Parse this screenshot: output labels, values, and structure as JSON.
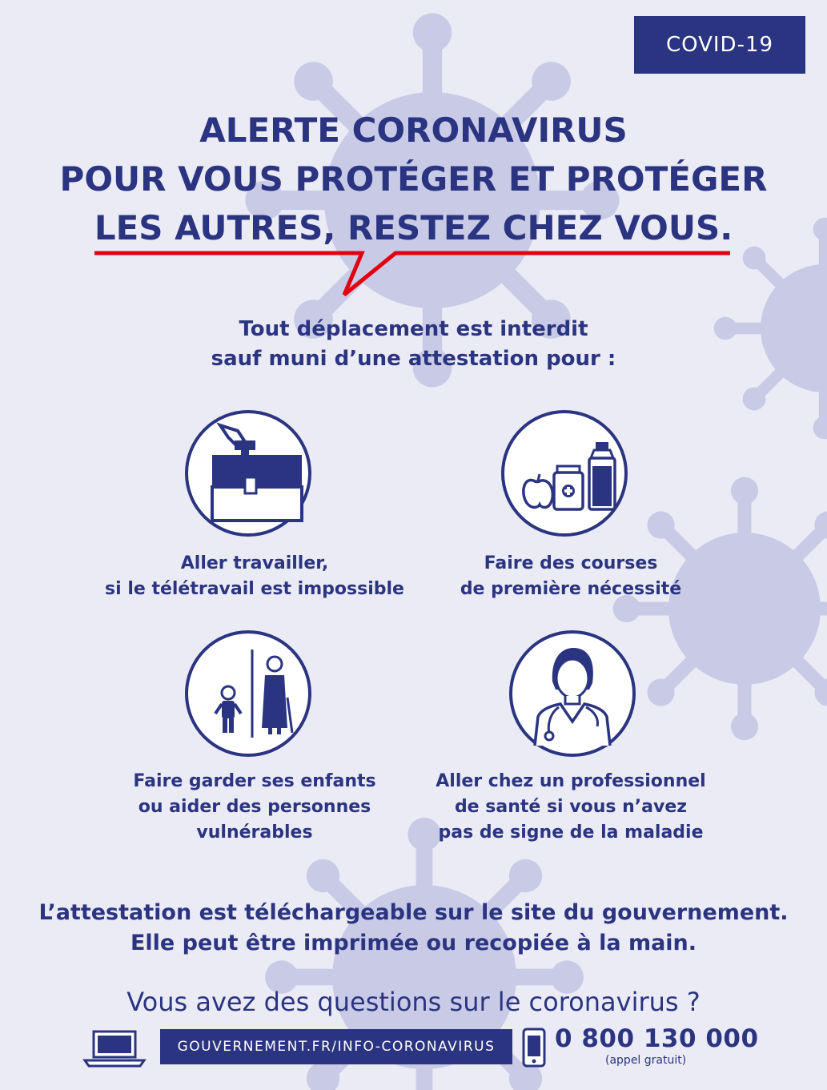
{
  "badge": "COVID-19",
  "headline": [
    "ALERTE CORONAVIRUS",
    "POUR VOUS PROTÉGER ET PROTÉGER",
    "LES AUTRES, RESTEZ CHEZ VOUS."
  ],
  "intro": [
    "Tout déplacement est interdit",
    "sauf muni d’une attestation pour :"
  ],
  "reasons": [
    {
      "icon": "briefcase-icon",
      "lines": [
        "Aller travailler,",
        "si le télétravail est impossible"
      ]
    },
    {
      "icon": "groceries-icon",
      "lines": [
        "Faire des courses",
        "de première nécessité"
      ]
    },
    {
      "icon": "child-elderly-icon",
      "lines": [
        "Faire garder ses enfants",
        "ou aider des personnes",
        "vulnérables"
      ]
    },
    {
      "icon": "doctor-icon",
      "lines": [
        "Aller chez un professionnel",
        "de santé si vous n’avez",
        "pas de signe de la maladie"
      ]
    }
  ],
  "attestation": [
    "L’attestation est téléchargeable sur le site du gouvernement.",
    "Elle peut être imprimée ou recopiée à la main."
  ],
  "questions": "Vous avez des questions sur le coronavirus ?",
  "url": "GOUVERNEMENT.FR/INFO-CORONAVIRUS",
  "phone": "0 800 130 000",
  "phone_note": "(appel gratuit)",
  "colors": {
    "navy": "#2b3480",
    "red": "#e1000f",
    "background": "#ebebf6",
    "virus": "#c9cbe6"
  }
}
